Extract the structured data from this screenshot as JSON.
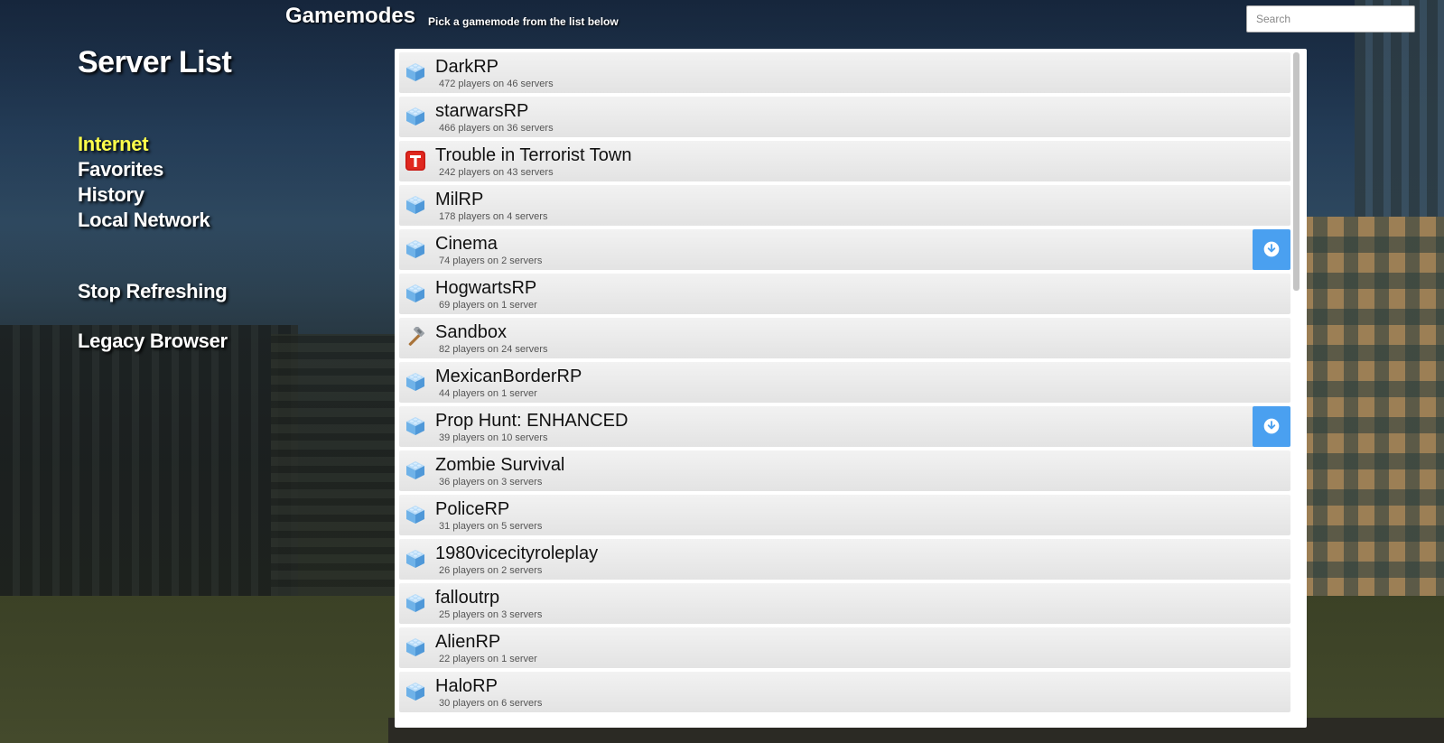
{
  "header": {
    "title": "Gamemodes",
    "subtitle": "Pick a gamemode from the list below",
    "search_placeholder": "Search"
  },
  "sidebar": {
    "title": "Server List",
    "nav": [
      {
        "label": "Internet",
        "active": true
      },
      {
        "label": "Favorites",
        "active": false
      },
      {
        "label": "History",
        "active": false
      },
      {
        "label": "Local Network",
        "active": false
      }
    ],
    "stop_refreshing": "Stop Refreshing",
    "legacy_browser": "Legacy Browser"
  },
  "colors": {
    "active_nav": "#ffff4a",
    "download_button": "#4aa0f0"
  },
  "gamemodes": [
    {
      "name": "DarkRP",
      "info": "472 players on 46 servers",
      "icon": "cube-icon",
      "download": false
    },
    {
      "name": "starwarsRP",
      "info": "466 players on 36 servers",
      "icon": "cube-icon",
      "download": false
    },
    {
      "name": "Trouble in Terrorist Town",
      "info": "242 players on 43 servers",
      "icon": "ttt-icon",
      "download": false
    },
    {
      "name": "MilRP",
      "info": "178 players on 4 servers",
      "icon": "cube-icon",
      "download": false
    },
    {
      "name": "Cinema",
      "info": "74 players on 2 servers",
      "icon": "cube-icon",
      "download": true
    },
    {
      "name": "HogwartsRP",
      "info": "69 players on 1 server",
      "icon": "cube-icon",
      "download": false
    },
    {
      "name": "Sandbox",
      "info": "82 players on 24 servers",
      "icon": "hammer-icon",
      "download": false
    },
    {
      "name": "MexicanBorderRP",
      "info": "44 players on 1 server",
      "icon": "cube-icon",
      "download": false
    },
    {
      "name": "Prop Hunt: ENHANCED",
      "info": "39 players on 10 servers",
      "icon": "cube-icon",
      "download": true
    },
    {
      "name": "Zombie Survival",
      "info": "36 players on 3 servers",
      "icon": "cube-icon",
      "download": false
    },
    {
      "name": "PoliceRP",
      "info": "31 players on 5 servers",
      "icon": "cube-icon",
      "download": false
    },
    {
      "name": "1980vicecityroleplay",
      "info": "26 players on 2 servers",
      "icon": "cube-icon",
      "download": false
    },
    {
      "name": "falloutrp",
      "info": "25 players on 3 servers",
      "icon": "cube-icon",
      "download": false
    },
    {
      "name": "AlienRP",
      "info": "22 players on 1 server",
      "icon": "cube-icon",
      "download": false
    },
    {
      "name": "HaloRP",
      "info": "30 players on 6 servers",
      "icon": "cube-icon",
      "download": false
    }
  ]
}
